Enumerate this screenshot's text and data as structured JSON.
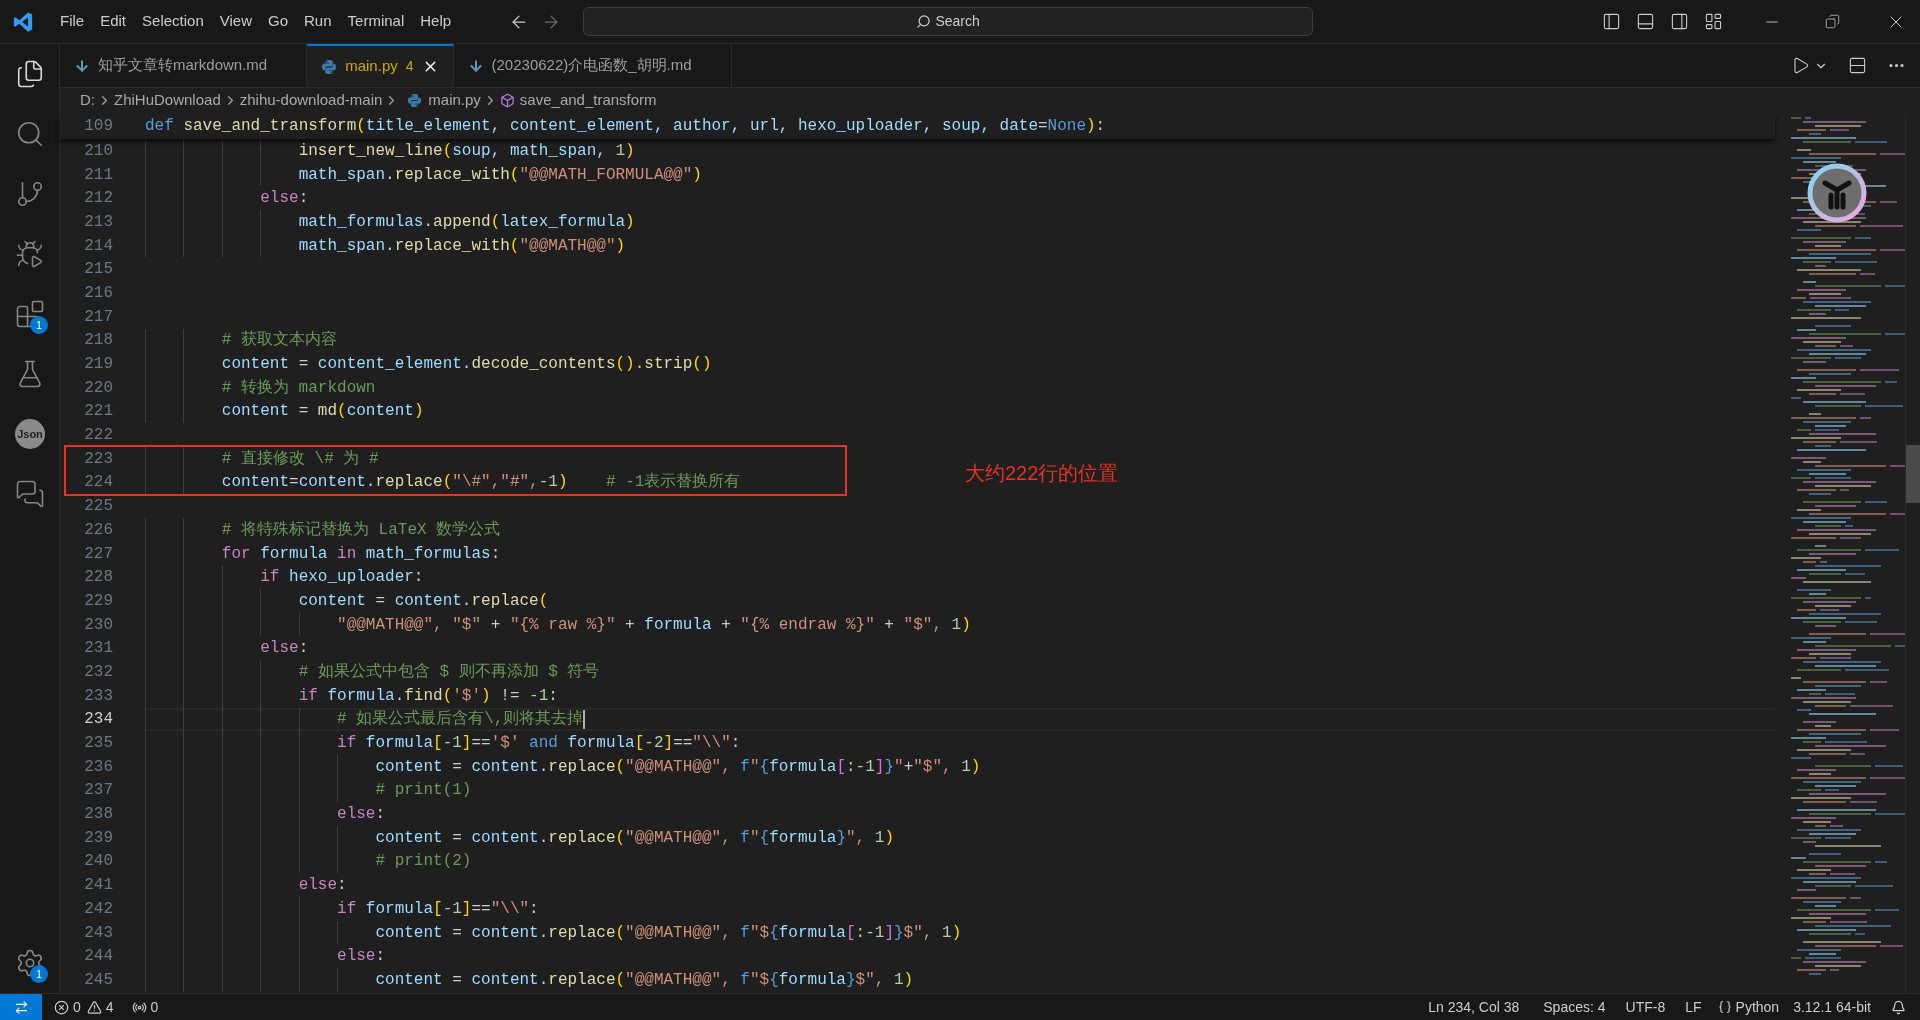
{
  "title_bar": {
    "menu": [
      "File",
      "Edit",
      "Selection",
      "View",
      "Go",
      "Run",
      "Terminal",
      "Help"
    ],
    "search": {
      "placeholder": "Search"
    }
  },
  "activity_bar": {
    "items": [
      {
        "kind": "files"
      },
      {
        "kind": "search"
      },
      {
        "kind": "source-control"
      },
      {
        "kind": "run-debug"
      },
      {
        "kind": "extensions",
        "badge": "1"
      },
      {
        "kind": "testing"
      },
      {
        "kind": "json",
        "label": "Json"
      },
      {
        "kind": "comments"
      }
    ],
    "bottom": [
      {
        "kind": "settings",
        "badge": "1"
      }
    ]
  },
  "tabs": [
    {
      "label": "知乎文章转markdown.md",
      "kind": "markdown",
      "selected": false
    },
    {
      "label": "main.py",
      "kind": "python",
      "problems": "4",
      "selected": true
    },
    {
      "label": "(20230622)介电函数_胡明.md",
      "kind": "markdown",
      "selected": false
    }
  ],
  "breadcrumb": [
    {
      "text": "D:",
      "kind": "folder"
    },
    {
      "text": "ZhiHuDownload",
      "kind": "folder"
    },
    {
      "text": "zhihu-download-main",
      "kind": "folder"
    },
    {
      "text": "main.py",
      "kind": "python"
    },
    {
      "text": "save_and_transform",
      "kind": "function"
    }
  ],
  "editor": {
    "sticky_line": {
      "num": "109",
      "tokens": [
        {
          "t": "def ",
          "color": "#569cd6"
        },
        {
          "t": "save_and_transform",
          "color": "#dcdcaa"
        },
        {
          "t": "(",
          "color": "#ffd700"
        },
        {
          "t": "title_element, ",
          "color": "#9cdcfe"
        },
        {
          "t": "content_element, ",
          "color": "#9cdcfe"
        },
        {
          "t": "author, ",
          "color": "#9cdcfe"
        },
        {
          "t": "url, ",
          "color": "#9cdcfe"
        },
        {
          "t": "hexo_uploader, ",
          "color": "#9cdcfe"
        },
        {
          "t": "soup, ",
          "color": "#9cdcfe"
        },
        {
          "t": "date",
          "color": "#9cdcfe"
        },
        {
          "t": "=",
          "color": "#cccccc"
        },
        {
          "t": "None",
          "color": "#569cd6"
        },
        {
          "t": ")",
          "color": "#ffd700"
        },
        {
          "t": ":",
          "color": "#cccccc"
        }
      ]
    },
    "lines": [
      {
        "num": "210",
        "current": false,
        "boxed": false,
        "tokens": [
          {
            "t": "                insert_new_line",
            "color": "#dcdcaa"
          },
          {
            "t": "(",
            "color": "#ffd700"
          },
          {
            "t": "soup, ",
            "color": "#9cdcfe"
          },
          {
            "t": "math_span, ",
            "color": "#9cdcfe"
          },
          {
            "t": "1",
            "color": "#b5cea8"
          },
          {
            "t": ")",
            "color": "#ffd700"
          }
        ]
      },
      {
        "num": "211",
        "current": false,
        "boxed": false,
        "tokens": [
          {
            "t": "                math_span.",
            "color": "#9cdcfe"
          },
          {
            "t": "replace_with",
            "color": "#dcdcaa"
          },
          {
            "t": "(",
            "color": "#ffd700"
          },
          {
            "t": "\"@@MATH_FORMULA@@\"",
            "color": "#ce9178"
          },
          {
            "t": ")",
            "color": "#ffd700"
          }
        ]
      },
      {
        "num": "212",
        "current": false,
        "boxed": false,
        "tokens": [
          {
            "t": "            else",
            "color": "#c586c0"
          },
          {
            "t": ":",
            "color": "#cccccc"
          }
        ]
      },
      {
        "num": "213",
        "current": false,
        "boxed": false,
        "tokens": [
          {
            "t": "                math_formulas.",
            "color": "#9cdcfe"
          },
          {
            "t": "append",
            "color": "#dcdcaa"
          },
          {
            "t": "(",
            "color": "#ffd700"
          },
          {
            "t": "latex_formula",
            "color": "#9cdcfe"
          },
          {
            "t": ")",
            "color": "#ffd700"
          }
        ]
      },
      {
        "num": "214",
        "current": false,
        "boxed": false,
        "tokens": [
          {
            "t": "                math_span.",
            "color": "#9cdcfe"
          },
          {
            "t": "replace_with",
            "color": "#dcdcaa"
          },
          {
            "t": "(",
            "color": "#ffd700"
          },
          {
            "t": "\"@@MATH@@\"",
            "color": "#ce9178"
          },
          {
            "t": ")",
            "color": "#ffd700"
          }
        ]
      },
      {
        "num": "215",
        "current": false,
        "boxed": false
      },
      {
        "num": "216",
        "current": false,
        "boxed": false
      },
      {
        "num": "217",
        "current": false,
        "boxed": false
      },
      {
        "num": "218",
        "current": false,
        "boxed": false,
        "tokens": [
          {
            "t": "        # 获取文本内容",
            "color": "#6a9955"
          }
        ]
      },
      {
        "num": "219",
        "current": false,
        "boxed": false,
        "tokens": [
          {
            "t": "        content",
            "color": "#9cdcfe"
          },
          {
            "t": " = ",
            "color": "#cccccc"
          },
          {
            "t": "content_element.",
            "color": "#9cdcfe"
          },
          {
            "t": "decode_contents",
            "color": "#dcdcaa"
          },
          {
            "t": "().",
            "color": "#ffd700"
          },
          {
            "t": "strip",
            "color": "#dcdcaa"
          },
          {
            "t": "()",
            "color": "#ffd700"
          }
        ]
      },
      {
        "num": "220",
        "current": false,
        "boxed": false,
        "tokens": [
          {
            "t": "        # 转换为 markdown",
            "color": "#6a9955"
          }
        ]
      },
      {
        "num": "221",
        "current": false,
        "boxed": false,
        "tokens": [
          {
            "t": "        content",
            "color": "#9cdcfe"
          },
          {
            "t": " = ",
            "color": "#cccccc"
          },
          {
            "t": "md",
            "color": "#dcdcaa"
          },
          {
            "t": "(",
            "color": "#ffd700"
          },
          {
            "t": "content",
            "color": "#9cdcfe"
          },
          {
            "t": ")",
            "color": "#ffd700"
          }
        ]
      },
      {
        "num": "222",
        "current": false,
        "boxed": false
      },
      {
        "num": "223",
        "current": false,
        "boxed": true,
        "tokens": [
          {
            "t": "        # 直接修改 \\# 为 #",
            "color": "#6a9955"
          }
        ]
      },
      {
        "num": "224",
        "current": false,
        "boxed": true,
        "tokens": [
          {
            "t": "        content",
            "color": "#9cdcfe"
          },
          {
            "t": "=",
            "color": "#cccccc"
          },
          {
            "t": "content.",
            "color": "#9cdcfe"
          },
          {
            "t": "replace",
            "color": "#dcdcaa"
          },
          {
            "t": "(",
            "color": "#ffd700"
          },
          {
            "t": "\"\\#\",\"#\",",
            "color": "#ce9178"
          },
          {
            "t": "-1",
            "color": "#b5cea8"
          },
          {
            "t": ")",
            "color": "#ffd700"
          },
          {
            "t": "    # -1表示替换所有",
            "color": "#6a9955"
          }
        ]
      },
      {
        "num": "225",
        "current": false,
        "boxed": false
      },
      {
        "num": "226",
        "current": false,
        "boxed": false,
        "tokens": [
          {
            "t": "        # 将特殊标记替换为 LaTeX 数学公式",
            "color": "#6a9955"
          }
        ]
      },
      {
        "num": "227",
        "current": false,
        "boxed": false,
        "tokens": [
          {
            "t": "        for",
            "color": "#c586c0"
          },
          {
            "t": " formula",
            "color": "#9cdcfe"
          },
          {
            "t": " in",
            "color": "#c586c0"
          },
          {
            "t": " math_formulas",
            "color": "#9cdcfe"
          },
          {
            "t": ":",
            "color": "#cccccc"
          }
        ]
      },
      {
        "num": "228",
        "current": false,
        "boxed": false,
        "tokens": [
          {
            "t": "            if",
            "color": "#c586c0"
          },
          {
            "t": " hexo_uploader",
            "color": "#9cdcfe"
          },
          {
            "t": ":",
            "color": "#cccccc"
          }
        ]
      },
      {
        "num": "229",
        "current": false,
        "boxed": false,
        "tokens": [
          {
            "t": "                content",
            "color": "#9cdcfe"
          },
          {
            "t": " = ",
            "color": "#cccccc"
          },
          {
            "t": "content.",
            "color": "#9cdcfe"
          },
          {
            "t": "replace",
            "color": "#dcdcaa"
          },
          {
            "t": "(",
            "color": "#ffd700"
          }
        ]
      },
      {
        "num": "230",
        "current": false,
        "boxed": false,
        "tokens": [
          {
            "t": "                    \"@@MATH@@\", \"$\"",
            "color": "#ce9178"
          },
          {
            "t": " + ",
            "color": "#cccccc"
          },
          {
            "t": "\"{% raw %}\"",
            "color": "#ce9178"
          },
          {
            "t": " + ",
            "color": "#cccccc"
          },
          {
            "t": "formula",
            "color": "#9cdcfe"
          },
          {
            "t": " + ",
            "color": "#cccccc"
          },
          {
            "t": "\"{% endraw %}\"",
            "color": "#ce9178"
          },
          {
            "t": " + ",
            "color": "#cccccc"
          },
          {
            "t": "\"$\", ",
            "color": "#ce9178"
          },
          {
            "t": "1",
            "color": "#b5cea8"
          },
          {
            "t": ")",
            "color": "#ffd700"
          }
        ]
      },
      {
        "num": "231",
        "current": false,
        "boxed": false,
        "tokens": [
          {
            "t": "            else",
            "color": "#c586c0"
          },
          {
            "t": ":",
            "color": "#cccccc"
          }
        ]
      },
      {
        "num": "232",
        "current": false,
        "boxed": false,
        "tokens": [
          {
            "t": "                # 如果公式中包含 $ 则不再添加 $ 符号",
            "color": "#6a9955"
          }
        ]
      },
      {
        "num": "233",
        "current": false,
        "boxed": false,
        "tokens": [
          {
            "t": "                if",
            "color": "#c586c0"
          },
          {
            "t": " formula.",
            "color": "#9cdcfe"
          },
          {
            "t": "find",
            "color": "#dcdcaa"
          },
          {
            "t": "(",
            "color": "#ffd700"
          },
          {
            "t": "'$'",
            "color": "#ce9178"
          },
          {
            "t": ")",
            "color": "#ffd700"
          },
          {
            "t": " != ",
            "color": "#cccccc"
          },
          {
            "t": "-1",
            "color": "#b5cea8"
          },
          {
            "t": ":",
            "color": "#cccccc"
          }
        ]
      },
      {
        "num": "234",
        "current": true,
        "boxed": false,
        "tokens": [
          {
            "t": "                    # 如果公式最后含有\\,则将其去掉",
            "color": "#6a9955"
          }
        ]
      },
      {
        "num": "235",
        "current": false,
        "boxed": false,
        "tokens": [
          {
            "t": "                    if",
            "color": "#c586c0"
          },
          {
            "t": " formula",
            "color": "#9cdcfe"
          },
          {
            "t": "[",
            "color": "#ffd700"
          },
          {
            "t": "-1",
            "color": "#b5cea8"
          },
          {
            "t": "]",
            "color": "#ffd700"
          },
          {
            "t": "==",
            "color": "#cccccc"
          },
          {
            "t": "'$'",
            "color": "#ce9178"
          },
          {
            "t": " and",
            "color": "#569cd6"
          },
          {
            "t": " formula",
            "color": "#9cdcfe"
          },
          {
            "t": "[",
            "color": "#ffd700"
          },
          {
            "t": "-2",
            "color": "#b5cea8"
          },
          {
            "t": "]",
            "color": "#ffd700"
          },
          {
            "t": "==",
            "color": "#cccccc"
          },
          {
            "t": "\"\\\\\"",
            "color": "#ce9178"
          },
          {
            "t": ":",
            "color": "#cccccc"
          }
        ]
      },
      {
        "num": "236",
        "current": false,
        "boxed": false,
        "tokens": [
          {
            "t": "                        content",
            "color": "#9cdcfe"
          },
          {
            "t": " = ",
            "color": "#cccccc"
          },
          {
            "t": "content.",
            "color": "#9cdcfe"
          },
          {
            "t": "replace",
            "color": "#dcdcaa"
          },
          {
            "t": "(",
            "color": "#ffd700"
          },
          {
            "t": "\"@@MATH@@\", ",
            "color": "#ce9178"
          },
          {
            "t": "f",
            "color": "#569cd6"
          },
          {
            "t": "\"",
            "color": "#ce9178"
          },
          {
            "t": "{",
            "color": "#569cd6"
          },
          {
            "t": "formula",
            "color": "#9cdcfe"
          },
          {
            "t": "[",
            "color": "#da70d6"
          },
          {
            "t": ":-1",
            "color": "#b5cea8"
          },
          {
            "t": "]",
            "color": "#da70d6"
          },
          {
            "t": "}",
            "color": "#569cd6"
          },
          {
            "t": "\"",
            "color": "#ce9178"
          },
          {
            "t": "+",
            "color": "#cccccc"
          },
          {
            "t": "\"$\", ",
            "color": "#ce9178"
          },
          {
            "t": "1",
            "color": "#b5cea8"
          },
          {
            "t": ")",
            "color": "#ffd700"
          }
        ]
      },
      {
        "num": "237",
        "current": false,
        "boxed": false,
        "tokens": [
          {
            "t": "                        # print(1)",
            "color": "#6a9955"
          }
        ]
      },
      {
        "num": "238",
        "current": false,
        "boxed": false,
        "tokens": [
          {
            "t": "                    else",
            "color": "#c586c0"
          },
          {
            "t": ":",
            "color": "#cccccc"
          }
        ]
      },
      {
        "num": "239",
        "current": false,
        "boxed": false,
        "tokens": [
          {
            "t": "                        content",
            "color": "#9cdcfe"
          },
          {
            "t": " = ",
            "color": "#cccccc"
          },
          {
            "t": "content.",
            "color": "#9cdcfe"
          },
          {
            "t": "replace",
            "color": "#dcdcaa"
          },
          {
            "t": "(",
            "color": "#ffd700"
          },
          {
            "t": "\"@@MATH@@\", ",
            "color": "#ce9178"
          },
          {
            "t": "f",
            "color": "#569cd6"
          },
          {
            "t": "\"",
            "color": "#ce9178"
          },
          {
            "t": "{",
            "color": "#569cd6"
          },
          {
            "t": "formula",
            "color": "#9cdcfe"
          },
          {
            "t": "}",
            "color": "#569cd6"
          },
          {
            "t": "\", ",
            "color": "#ce9178"
          },
          {
            "t": "1",
            "color": "#b5cea8"
          },
          {
            "t": ")",
            "color": "#ffd700"
          }
        ]
      },
      {
        "num": "240",
        "current": false,
        "boxed": false,
        "tokens": [
          {
            "t": "                        # print(2)",
            "color": "#6a9955"
          }
        ]
      },
      {
        "num": "241",
        "current": false,
        "boxed": false,
        "tokens": [
          {
            "t": "                else",
            "color": "#c586c0"
          },
          {
            "t": ":",
            "color": "#cccccc"
          }
        ]
      },
      {
        "num": "242",
        "current": false,
        "boxed": false,
        "tokens": [
          {
            "t": "                    if",
            "color": "#c586c0"
          },
          {
            "t": " formula",
            "color": "#9cdcfe"
          },
          {
            "t": "[",
            "color": "#ffd700"
          },
          {
            "t": "-1",
            "color": "#b5cea8"
          },
          {
            "t": "]",
            "color": "#ffd700"
          },
          {
            "t": "==",
            "color": "#cccccc"
          },
          {
            "t": "\"\\\\\"",
            "color": "#ce9178"
          },
          {
            "t": ":",
            "color": "#cccccc"
          }
        ]
      },
      {
        "num": "243",
        "current": false,
        "boxed": false,
        "tokens": [
          {
            "t": "                        content",
            "color": "#9cdcfe"
          },
          {
            "t": " = ",
            "color": "#cccccc"
          },
          {
            "t": "content.",
            "color": "#9cdcfe"
          },
          {
            "t": "replace",
            "color": "#dcdcaa"
          },
          {
            "t": "(",
            "color": "#ffd700"
          },
          {
            "t": "\"@@MATH@@\", ",
            "color": "#ce9178"
          },
          {
            "t": "f",
            "color": "#569cd6"
          },
          {
            "t": "\"$",
            "color": "#ce9178"
          },
          {
            "t": "{",
            "color": "#569cd6"
          },
          {
            "t": "formula",
            "color": "#9cdcfe"
          },
          {
            "t": "[",
            "color": "#da70d6"
          },
          {
            "t": ":-1",
            "color": "#b5cea8"
          },
          {
            "t": "]",
            "color": "#da70d6"
          },
          {
            "t": "}",
            "color": "#569cd6"
          },
          {
            "t": "$\", ",
            "color": "#ce9178"
          },
          {
            "t": "1",
            "color": "#b5cea8"
          },
          {
            "t": ")",
            "color": "#ffd700"
          }
        ]
      },
      {
        "num": "244",
        "current": false,
        "boxed": false,
        "tokens": [
          {
            "t": "                    else",
            "color": "#c586c0"
          },
          {
            "t": ":",
            "color": "#cccccc"
          }
        ]
      },
      {
        "num": "245",
        "current": false,
        "boxed": false,
        "tokens": [
          {
            "t": "                        content",
            "color": "#9cdcfe"
          },
          {
            "t": " = ",
            "color": "#cccccc"
          },
          {
            "t": "content.",
            "color": "#9cdcfe"
          },
          {
            "t": "replace",
            "color": "#dcdcaa"
          },
          {
            "t": "(",
            "color": "#ffd700"
          },
          {
            "t": "\"@@MATH@@\", ",
            "color": "#ce9178"
          },
          {
            "t": "f",
            "color": "#569cd6"
          },
          {
            "t": "\"$",
            "color": "#ce9178"
          },
          {
            "t": "{",
            "color": "#569cd6"
          },
          {
            "t": "formula",
            "color": "#9cdcfe"
          },
          {
            "t": "}",
            "color": "#569cd6"
          },
          {
            "t": "$\", ",
            "color": "#ce9178"
          },
          {
            "t": "1",
            "color": "#b5cea8"
          },
          {
            "t": ")",
            "color": "#ffd700"
          }
        ]
      }
    ],
    "annotation": {
      "text": "大约222行的位置"
    }
  },
  "status_bar": {
    "errors": "0",
    "warnings": "4",
    "ports": "0",
    "position": "Ln 234, Col 38",
    "indent": "Spaces: 4",
    "encoding": "UTF-8",
    "eol": "LF",
    "language": "Python",
    "interpreter": "3.12.1 64-bit"
  }
}
